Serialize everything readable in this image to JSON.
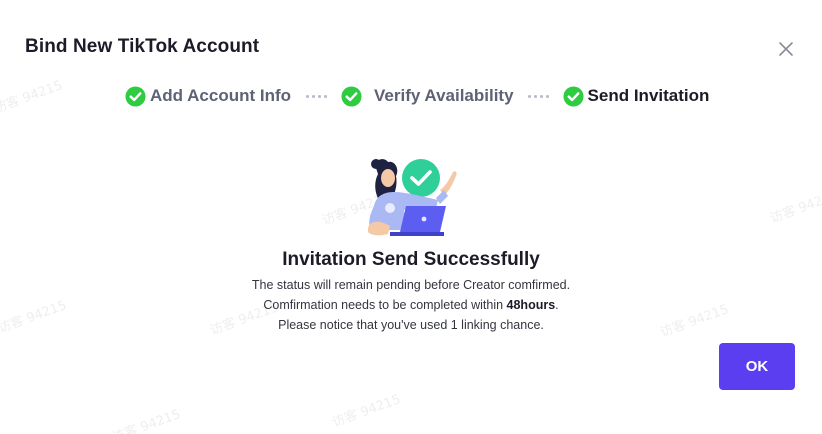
{
  "dialog": {
    "title": "Bind New TikTok Account",
    "close_icon": "close-icon"
  },
  "steps": [
    {
      "label": "Add Account Info",
      "icon": "check-circle-icon",
      "status": "done"
    },
    {
      "label": "Verify Availability",
      "icon": "check-circle-icon",
      "status": "done"
    },
    {
      "label": "Send Invitation",
      "icon": "check-circle-icon",
      "status": "done"
    }
  ],
  "result": {
    "illustration": "woman-laptop-success-illustration",
    "title": "Invitation Send Successfully",
    "line1": "The status will remain pending before Creator comfirmed.",
    "line2_prefix": "Comfirmation needs to be completed within ",
    "line2_bold": "48hours",
    "line2_suffix": ".",
    "line3": "Please notice that you've used 1 linking chance."
  },
  "actions": {
    "ok_label": "OK"
  },
  "watermark": "访客 94215",
  "colors": {
    "accent": "#5b3ef0",
    "check": "#2ecc40",
    "illustration_teal": "#2fcf9a",
    "illustration_purple": "#5b5ef0"
  }
}
